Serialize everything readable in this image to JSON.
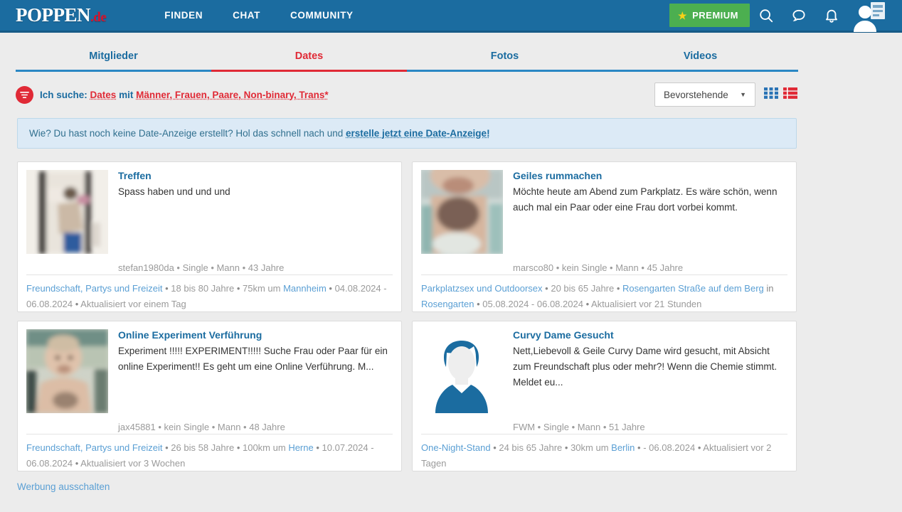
{
  "header": {
    "logo_main": "POPPEN",
    "logo_suffix": ".de",
    "nav": [
      {
        "label": "FINDEN"
      },
      {
        "label": "CHAT"
      },
      {
        "label": "COMMUNITY"
      }
    ],
    "premium_label": "PREMIUM",
    "premium_bg": "#4caf50",
    "premium_star_color": "#f7d117",
    "bar_color": "#1b6ca0",
    "icons": [
      "search-icon",
      "chat-bubble-icon",
      "bell-icon",
      "avatar"
    ]
  },
  "tabs": {
    "items": [
      {
        "label": "Mitglieder",
        "active": false
      },
      {
        "label": "Dates",
        "active": true
      },
      {
        "label": "Fotos",
        "active": false
      },
      {
        "label": "Videos",
        "active": false
      }
    ],
    "active_color": "#e02a36",
    "inactive_color": "#1b6ca0"
  },
  "filterbar": {
    "label_prefix": "Ich suche:",
    "search_type": "Dates",
    "connector": "mit",
    "genders": "Männer, Frauen, Paare, Non-binary, Trans*",
    "sort_value": "Bevorstehende",
    "view_grid_color": "#2a73b5",
    "view_list_color": "#e02a36"
  },
  "notice": {
    "text_before": "Wie? Du hast noch keine Date-Anzeige erstellt? Hol das schnell nach und ",
    "link": "erstelle jetzt eine Date-Anzeige!"
  },
  "cards": [
    {
      "title": "Treffen",
      "description": "Spass haben und und und",
      "meta": "stefan1980da • Single • Mann • 43 Jahre",
      "username": "stefan1980da",
      "relationship": "Single",
      "gender": "Mann",
      "age": "43 Jahre",
      "category": "Freundschaft, Partys und Freizeit",
      "age_range": "18 bis 80 Jahre",
      "distance": "75km um",
      "location": "Mannheim",
      "dates": "04.08.2024 - 06.08.2024",
      "updated": "Aktualisiert vor einem Tag",
      "avatar_type": "photo"
    },
    {
      "title": "Geiles rummachen",
      "description": "Möchte heute am Abend zum Parkplatz. Es wäre schön, wenn auch mal ein Paar oder eine Frau dort vorbei kommt.",
      "meta": "marsco80 • kein Single • Mann • 45 Jahre",
      "username": "marsco80",
      "relationship": "kein Single",
      "gender": "Mann",
      "age": "45 Jahre",
      "category": "Parkplatzsex und Outdoorsex",
      "age_range": "20 bis 65 Jahre",
      "distance": "",
      "location": "Rosengarten Straße auf dem Berg",
      "location_prefix": "in",
      "location_city": "Rosengarten",
      "dates": "05.08.2024 - 06.08.2024",
      "updated": "Aktualisiert vor 21 Stunden",
      "avatar_type": "photo"
    },
    {
      "title": "Online Experiment Verführung",
      "description": "Experiment !!!!! EXPERIMENT!!!!! Suche Frau oder Paar für ein online Experiment!! Es geht um eine Online Verführung. M...",
      "meta": "jax45881 • kein Single • Mann • 48 Jahre",
      "username": "jax45881",
      "relationship": "kein Single",
      "gender": "Mann",
      "age": "48 Jahre",
      "category": "Freundschaft, Partys und Freizeit",
      "age_range": "26 bis 58 Jahre",
      "distance": "100km um",
      "location": "Herne",
      "dates": "10.07.2024 - 06.08.2024",
      "updated": "Aktualisiert vor 3 Wochen",
      "avatar_type": "photo"
    },
    {
      "title": "Curvy Dame Gesucht",
      "description": "Nett,Liebevoll & Geile Curvy Dame wird gesucht, mit Absicht zum Freundschaft plus oder mehr?! Wenn die Chemie stimmt. Meldet eu...",
      "meta": "FWM • Single • Mann • 51 Jahre",
      "username": "FWM",
      "relationship": "Single",
      "gender": "Mann",
      "age": "51 Jahre",
      "category": "One-Night-Stand",
      "age_range": "24 bis 65 Jahre",
      "distance": "30km um",
      "location": "Berlin",
      "dates": "- 06.08.2024",
      "updated": "Aktualisiert vor 2 Tagen",
      "avatar_type": "placeholder"
    }
  ],
  "footer": {
    "ad_link": "Werbung ausschalten"
  }
}
